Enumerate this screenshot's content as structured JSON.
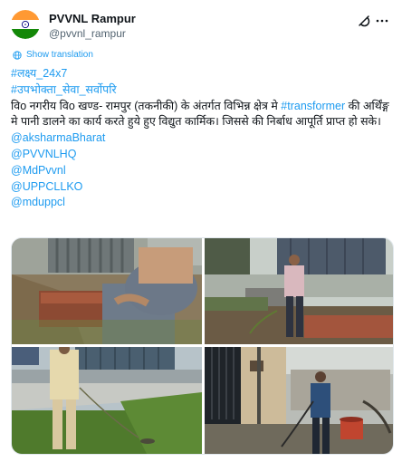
{
  "account": {
    "display_name": "PVVNL Rampur",
    "handle": "@pvvnl_rampur"
  },
  "translate_label": "Show translation",
  "post": {
    "hashtag_1": "#लक्ष्य_24x7",
    "hashtag_2": "#उपभोक्ता_सेवा_सर्वोपरि",
    "text_part_1": "विo नगरीय विo खण्ड- रामपुर (तकनीकी) के अंतर्गत विभिन्न क्षेत्र मे ",
    "text_link": "#transformer",
    "text_part_2": " की अर्थिंङ्ग मे पानी डालने का कार्य करते हुये हुए विद्युत कार्मिक। जिससे की निर्बाध आपूर्ति प्राप्त हो सके।",
    "mentions": [
      "@aksharmaBharat",
      "@PVVNLHQ",
      "@MdPvvnl",
      "@UPPCLLKO",
      "@mduppcl"
    ]
  },
  "icons": {
    "avatar": "india-flag-avatar-icon",
    "grok": "grok-icon",
    "more": "more-options-icon",
    "translate": "globe-icon"
  },
  "colors": {
    "link": "#1d9bf0",
    "text": "#0f1419",
    "secondary": "#536471"
  }
}
